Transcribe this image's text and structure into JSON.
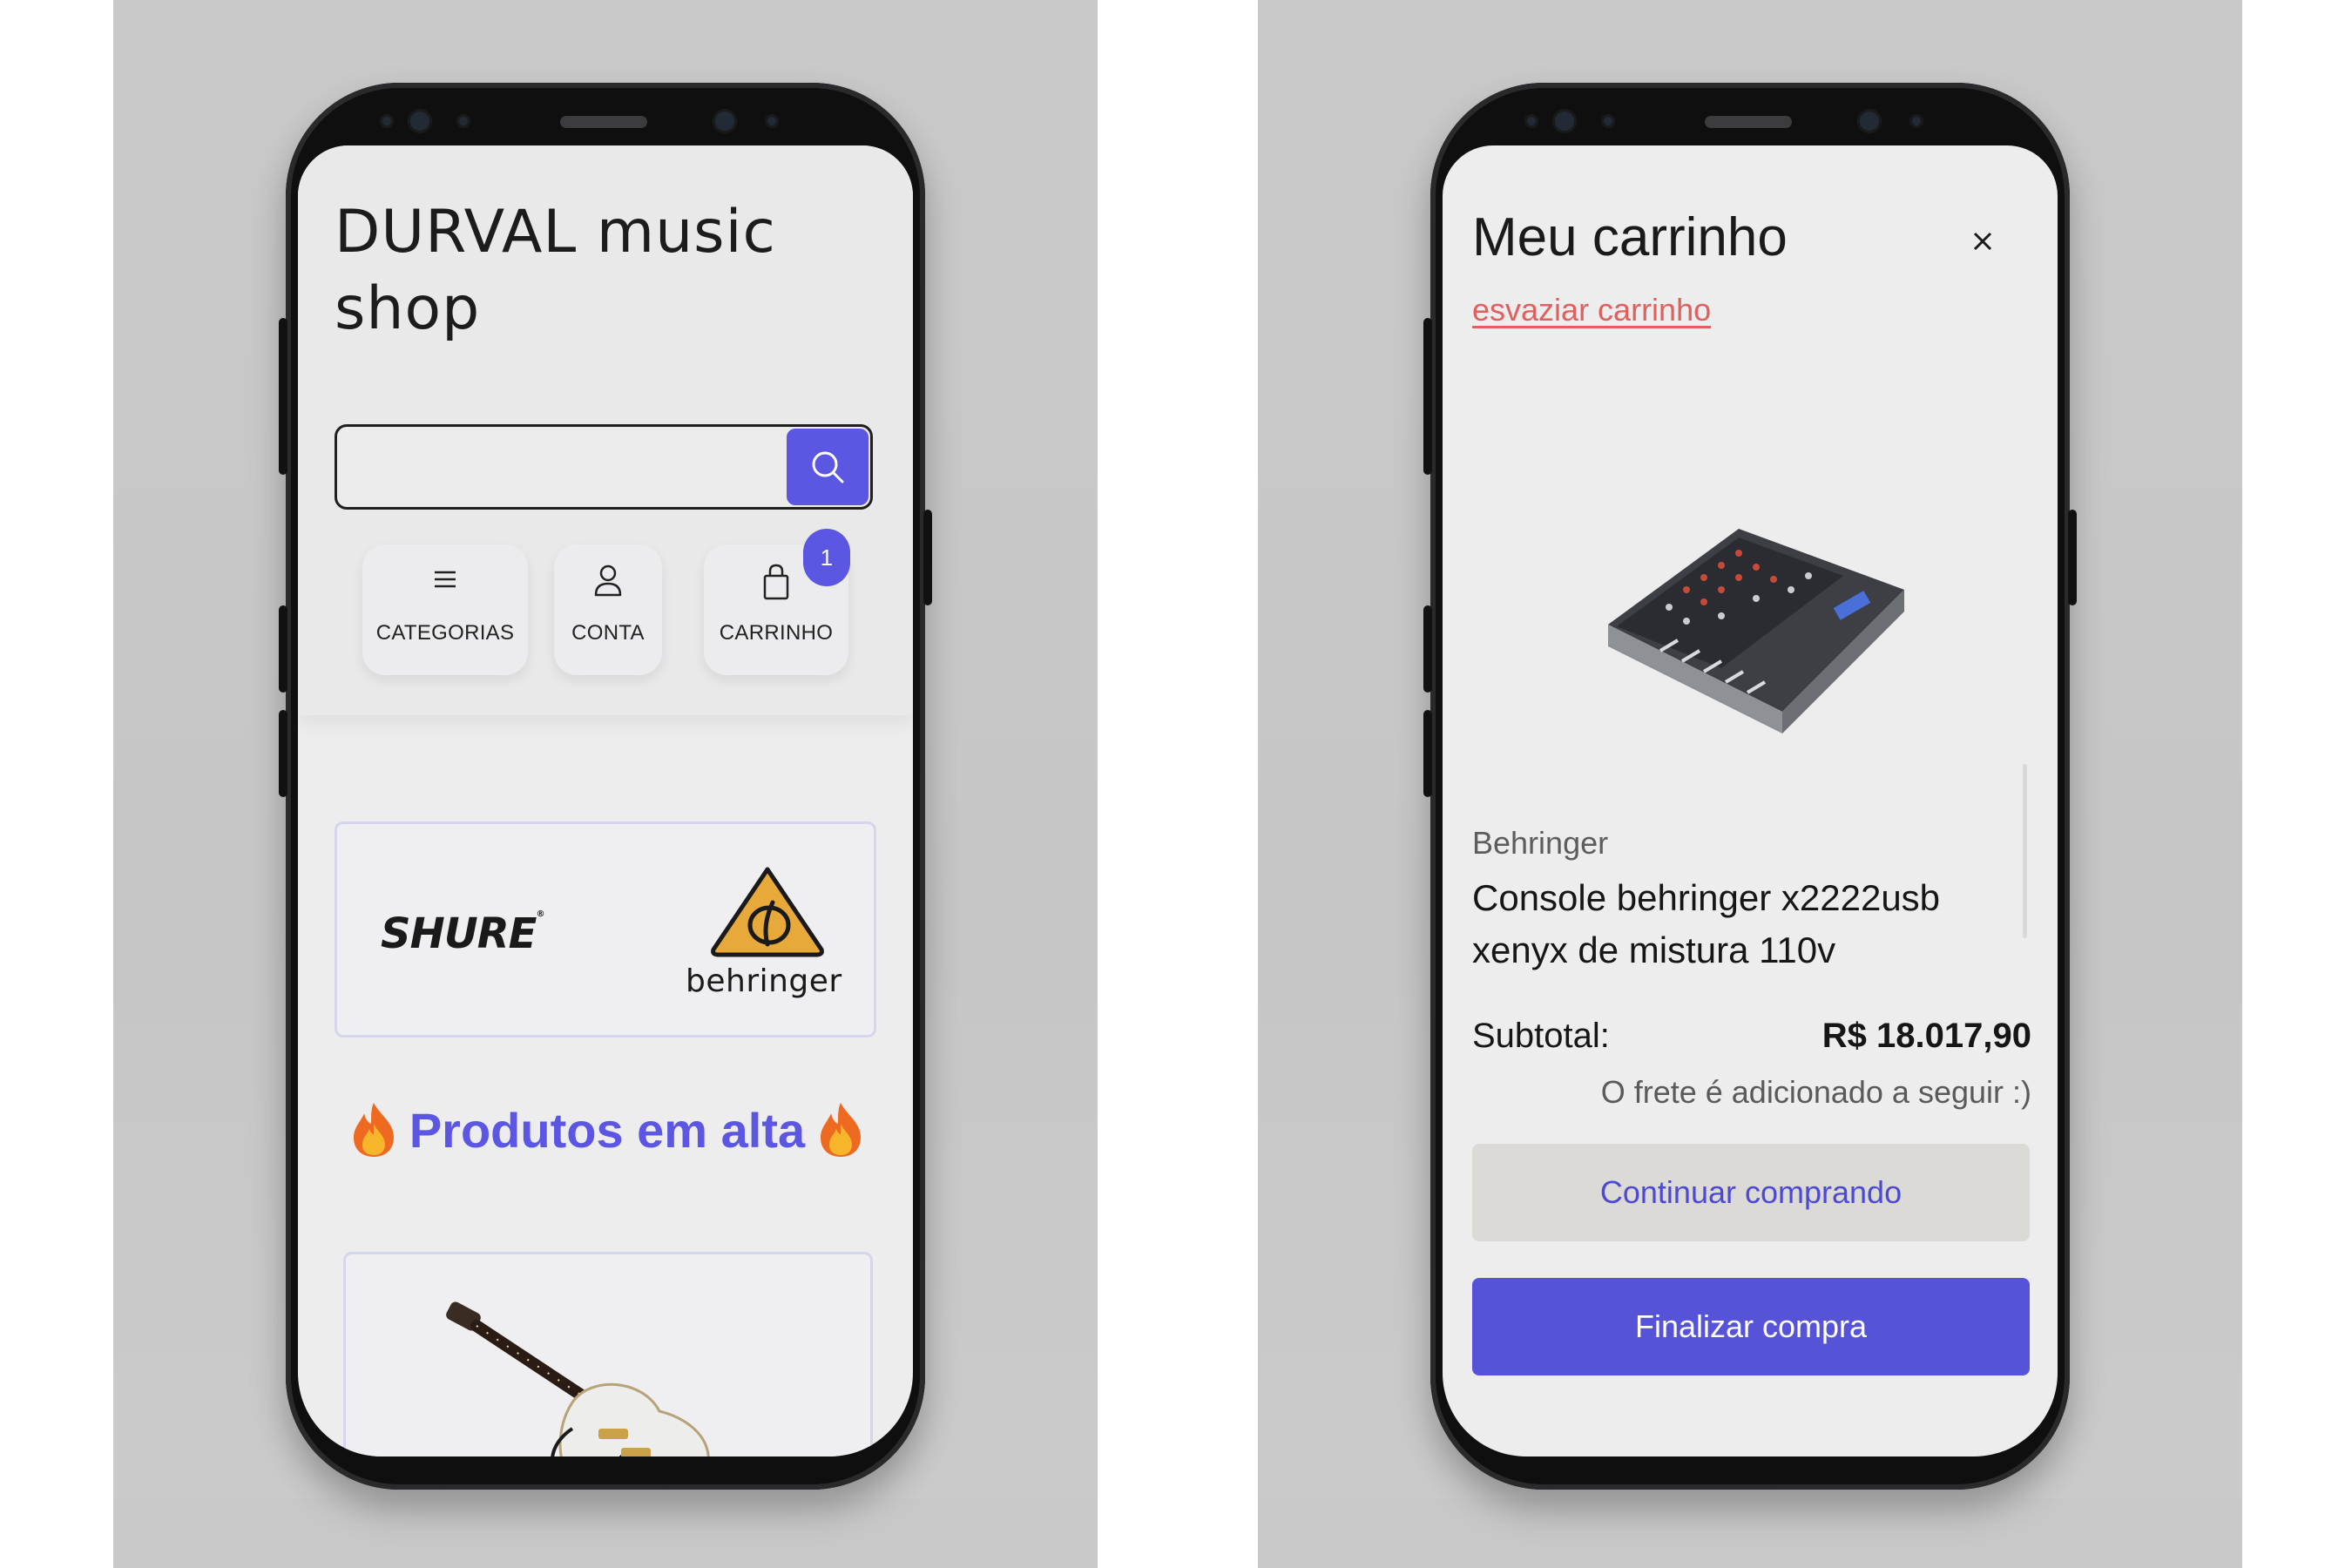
{
  "colors": {
    "accent": "#5b57e3",
    "danger_link": "#e0605d",
    "secondary_button": "#dcdad7",
    "behringer_logo": "#e6a93a"
  },
  "home": {
    "logo_text": "DURVAL music shop",
    "search": {
      "placeholder": "",
      "value": "",
      "button_icon": "search-icon"
    },
    "nav": {
      "categories_label": "CATEGORIAS",
      "categories_icon": "menu-icon",
      "account_label": "CONTA",
      "account_icon": "user-icon",
      "cart_label": "CARRINHO",
      "cart_icon": "shopping-bag-icon",
      "cart_badge": "1"
    },
    "brands": {
      "shure": "SHURE",
      "behringer": "behringer"
    },
    "trending_title": "Produtos em alta",
    "trending_icon": "fire-icon"
  },
  "cart": {
    "title": "Meu carrinho",
    "close_icon": "close-icon",
    "empty_link": "esvaziar carrinho",
    "item": {
      "brand": "Behringer",
      "name": "Console behringer x2222usb xenyx de mistura 110v"
    },
    "subtotal_label": "Subtotal:",
    "subtotal_value": "R$ 18.017,90",
    "shipping_note": "O frete é adicionado a seguir :)",
    "continue_label": "Continuar comprando",
    "checkout_label": "Finalizar compra"
  }
}
